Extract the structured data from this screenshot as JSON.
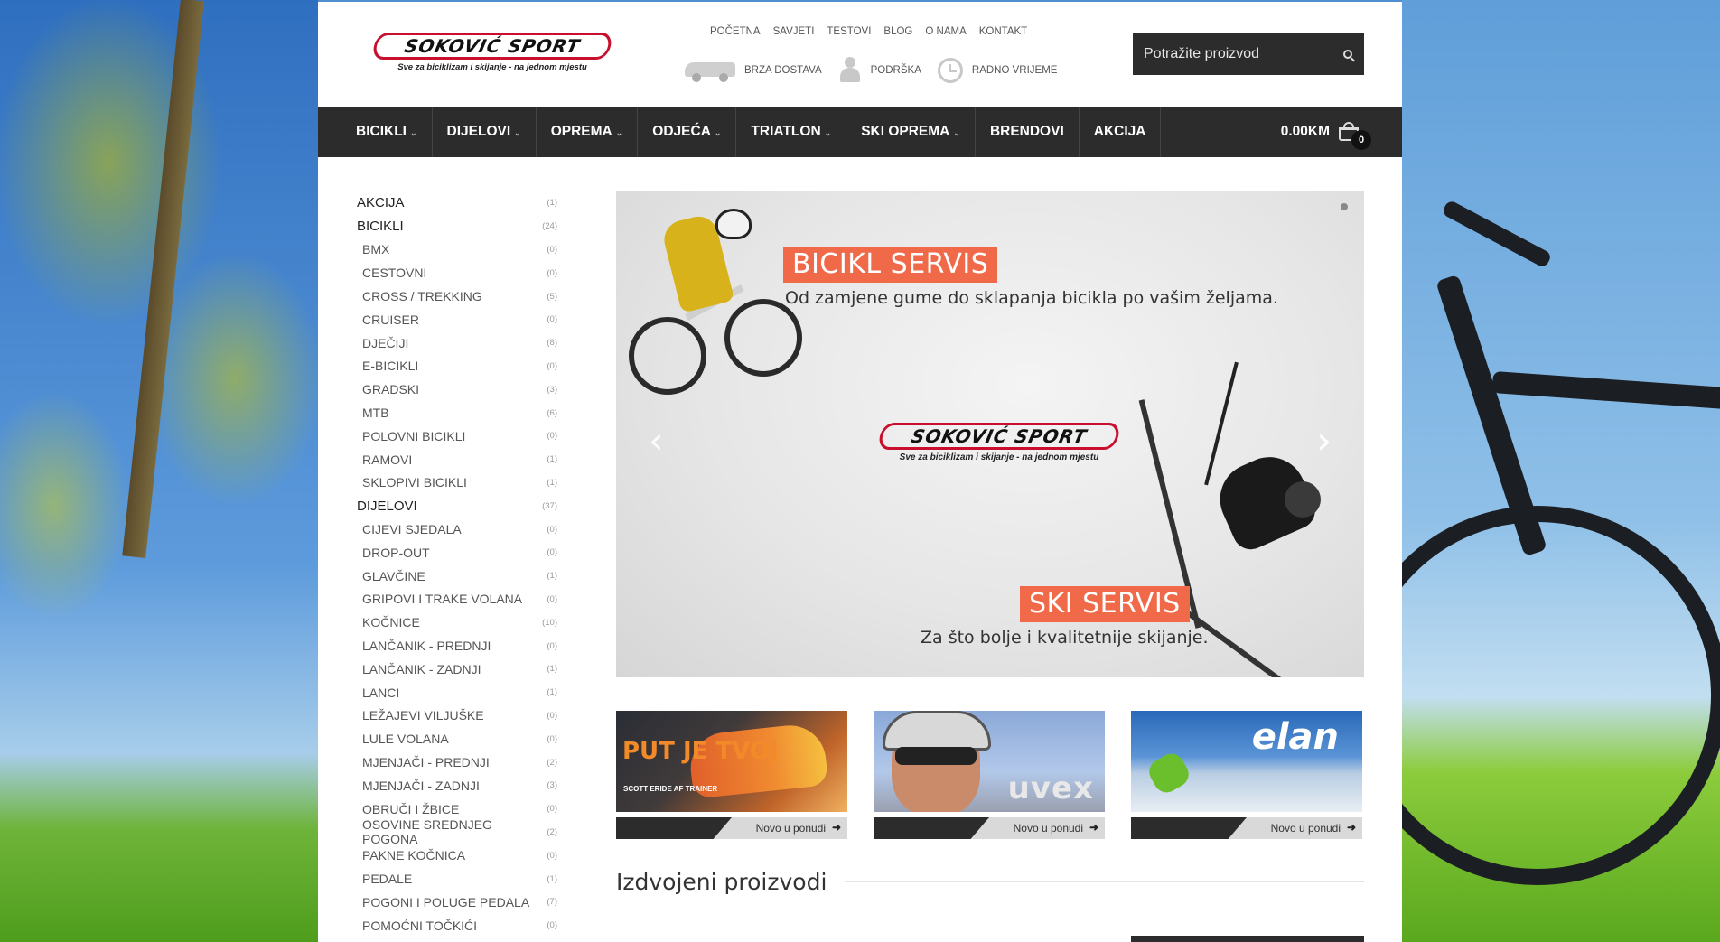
{
  "header": {
    "logo_text": "SOKOVIĆ SPORT",
    "logo_tagline": "Sve za biciklizam i skijanje - na jednom mjestu",
    "top_links": [
      "POČETNA",
      "SAVJETI",
      "TESTOVI",
      "BLOG",
      "O NAMA",
      "KONTAKT"
    ],
    "features": [
      {
        "icon": "delivery-van-icon",
        "label": "BRZA DOSTAVA"
      },
      {
        "icon": "support-person-icon",
        "label": "PODRŠKA"
      },
      {
        "icon": "clock-icon",
        "label": "RADNO VRIJEME"
      }
    ],
    "search_placeholder": "Potražite proizvod"
  },
  "menu": {
    "items": [
      {
        "label": "BICIKLI",
        "has_dropdown": true
      },
      {
        "label": "DIJELOVI",
        "has_dropdown": true
      },
      {
        "label": "OPREMA",
        "has_dropdown": true
      },
      {
        "label": "ODJEĆA",
        "has_dropdown": true
      },
      {
        "label": "TRIATLON",
        "has_dropdown": true
      },
      {
        "label": "SKI OPREMA",
        "has_dropdown": true
      },
      {
        "label": "BRENDOVI",
        "has_dropdown": false
      },
      {
        "label": "AKCIJA",
        "has_dropdown": false
      }
    ],
    "cart_total": "0.00KM",
    "cart_count": "0"
  },
  "sidebar": {
    "categories": [
      {
        "label": "AKCIJA",
        "count": "(1)",
        "level": "top"
      },
      {
        "label": "BICIKLI",
        "count": "(24)",
        "level": "top"
      },
      {
        "label": "BMX",
        "count": "(0)",
        "level": "sub"
      },
      {
        "label": "CESTOVNI",
        "count": "(0)",
        "level": "sub"
      },
      {
        "label": "CROSS / TREKKING",
        "count": "(5)",
        "level": "sub"
      },
      {
        "label": "CRUISER",
        "count": "(0)",
        "level": "sub"
      },
      {
        "label": "DJEČIJI",
        "count": "(8)",
        "level": "sub"
      },
      {
        "label": "E-BICIKLI",
        "count": "(0)",
        "level": "sub"
      },
      {
        "label": "GRADSKI",
        "count": "(3)",
        "level": "sub"
      },
      {
        "label": "MTB",
        "count": "(6)",
        "level": "sub"
      },
      {
        "label": "POLOVNI BICIKLI",
        "count": "(0)",
        "level": "sub"
      },
      {
        "label": "RAMOVI",
        "count": "(1)",
        "level": "sub"
      },
      {
        "label": "SKLOPIVI BICIKLI",
        "count": "(1)",
        "level": "sub"
      },
      {
        "label": "DIJELOVI",
        "count": "(37)",
        "level": "top"
      },
      {
        "label": "CIJEVI SJEDALA",
        "count": "(0)",
        "level": "sub"
      },
      {
        "label": "DROP-OUT",
        "count": "(0)",
        "level": "sub"
      },
      {
        "label": "GLAVČINE",
        "count": "(1)",
        "level": "sub"
      },
      {
        "label": "GRIPOVI I TRAKE VOLANA",
        "count": "(0)",
        "level": "sub"
      },
      {
        "label": "KOČNICE",
        "count": "(10)",
        "level": "sub"
      },
      {
        "label": "LANČANIK - PREDNJI",
        "count": "(0)",
        "level": "sub"
      },
      {
        "label": "LANČANIK - ZADNJI",
        "count": "(1)",
        "level": "sub"
      },
      {
        "label": "LANCI",
        "count": "(1)",
        "level": "sub"
      },
      {
        "label": "LEŽAJEVI VILJUŠKE",
        "count": "(0)",
        "level": "sub"
      },
      {
        "label": "LULE VOLANA",
        "count": "(0)",
        "level": "sub"
      },
      {
        "label": "MJENJAČI - PREDNJI",
        "count": "(2)",
        "level": "sub"
      },
      {
        "label": "MJENJAČI - ZADNJI",
        "count": "(3)",
        "level": "sub"
      },
      {
        "label": "OBRUČI I ŽBICE",
        "count": "(0)",
        "level": "sub"
      },
      {
        "label": "OSOVINE SREDNJEG POGONA",
        "count": "(2)",
        "level": "sub"
      },
      {
        "label": "PAKNE KOČNICA",
        "count": "(0)",
        "level": "sub"
      },
      {
        "label": "PEDALE",
        "count": "(1)",
        "level": "sub"
      },
      {
        "label": "POGONI I POLUGE PEDALA",
        "count": "(7)",
        "level": "sub"
      },
      {
        "label": "POMOĆNI TOČKIĆI",
        "count": "(0)",
        "level": "sub"
      }
    ]
  },
  "slider": {
    "tag1": "BICIKL SERVIS",
    "text1": "Od zamjene gume do sklapanja bicikla po vašim željama.",
    "tag2": "SKI SERVIS",
    "text2": "Za što bolje i kvalitetnije skijanje.",
    "logo_text": "SOKOVIĆ SPORT",
    "logo_tagline": "Sve za biciklizam i skijanje - na jednom mjestu"
  },
  "promos": [
    {
      "title": "PUT JE TVOJ",
      "subtitle": "SCOTT ERIDE AF TRAINER",
      "link": "Novo u ponudi"
    },
    {
      "title": "uvex",
      "link": "Novo u ponudi"
    },
    {
      "title": "elan",
      "link": "Novo u ponudi"
    }
  ],
  "featured": {
    "heading": "Izdvojeni proizvodi"
  },
  "colors": {
    "accent": "#f06a4a",
    "nav_bg": "#2c2c2c",
    "logo_red": "#c8102e"
  }
}
